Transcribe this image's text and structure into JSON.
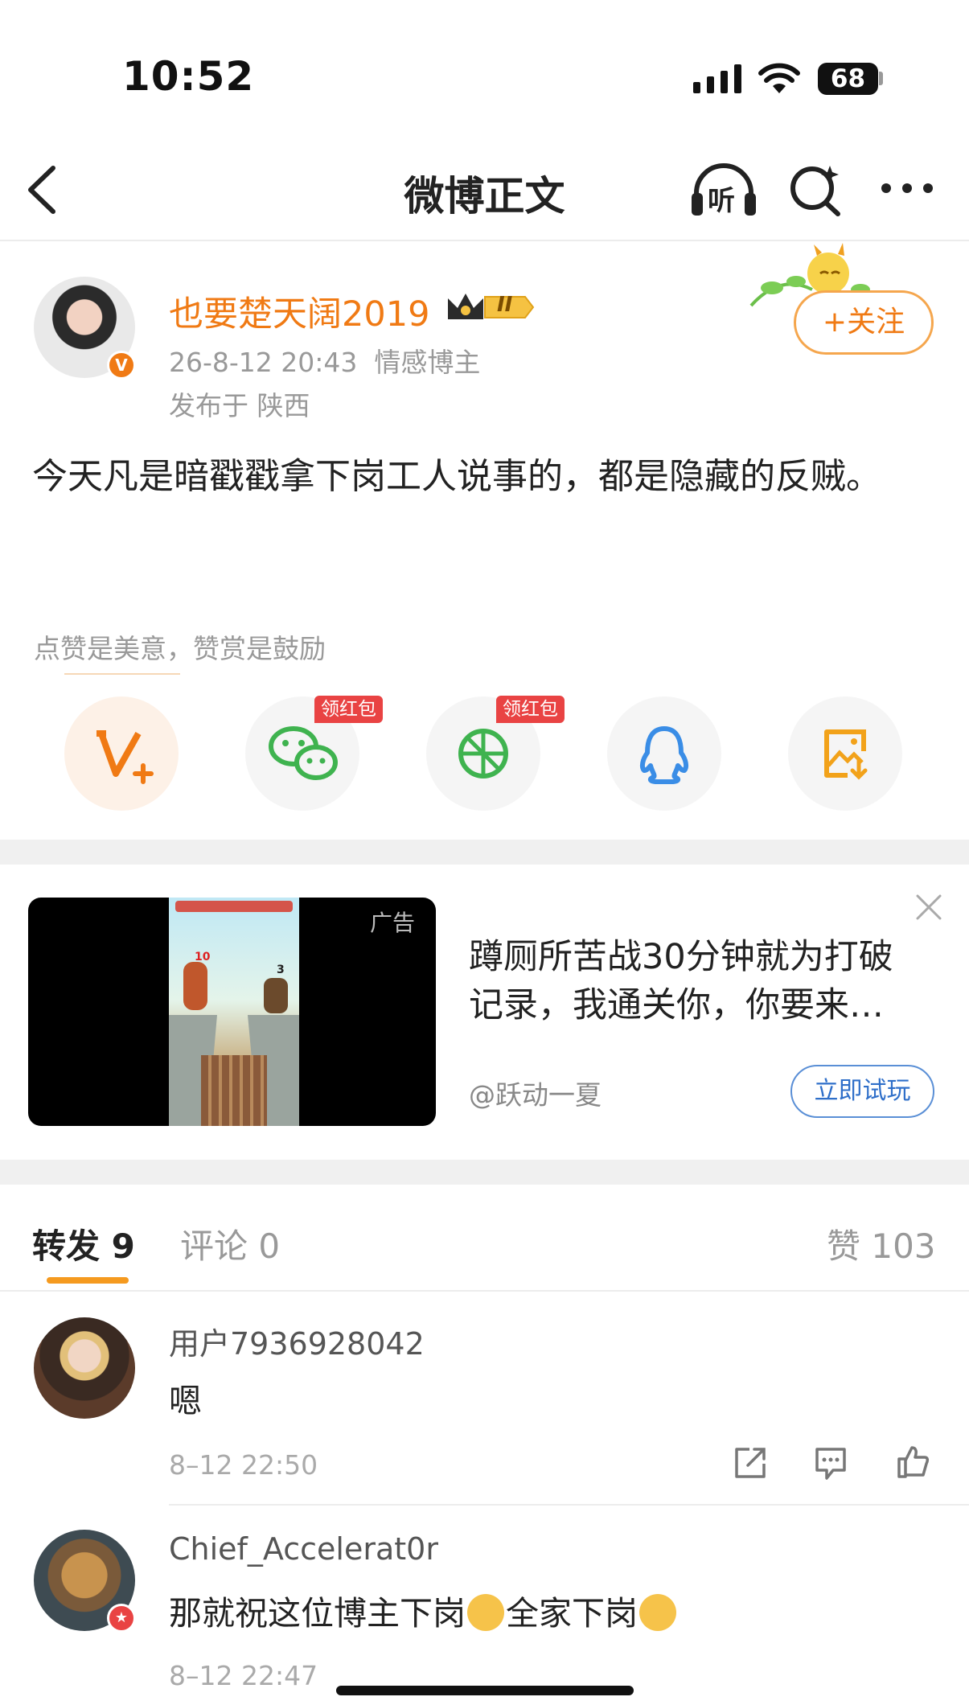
{
  "status_bar": {
    "time": "10:52",
    "battery": "68"
  },
  "nav": {
    "title": "微博正文",
    "listen_label": "听"
  },
  "post": {
    "author": "也要楚天阔2019",
    "level_badge": "II",
    "verified_badge": "V",
    "time": "26-8-12 20:43",
    "category": "情感博主",
    "location": "发布于 陕西",
    "follow_label": "+关注",
    "body": "今天凡是暗戳戳拿下岗工人说事的，都是隐藏的反贼。",
    "reward_text": "点赞是美意，赞赏是鼓励"
  },
  "share": {
    "red_packet_label_1": "领红包",
    "red_packet_label_2": "领红包",
    "items": [
      "v-plus-icon",
      "wechat-icon",
      "moments-icon",
      "qq-icon",
      "save-image-icon"
    ]
  },
  "ad": {
    "label": "广告",
    "title": "蹲厕所苦战30分钟就为打破记录，我通关你，你要来…",
    "source": "@跃动一夏",
    "cta": "立即试玩",
    "game_num_left": "10",
    "game_num_right": "3"
  },
  "tabs": {
    "repost": "转发 9",
    "comment": "评论 0",
    "like": "赞 103"
  },
  "comments": [
    {
      "user": "用户7936928042",
      "text": "嗯",
      "time": "8–12 22:50"
    },
    {
      "user": "Chief_Accelerat0r",
      "text_1": "那就祝这位博主下岗",
      "text_2": "全家下岗",
      "time": "8–12 22:47"
    }
  ],
  "colors": {
    "accent": "#f07a14",
    "tab_indicator": "#f59a1f",
    "link_blue": "#2f6fc9",
    "red_tag": "#e94343"
  }
}
